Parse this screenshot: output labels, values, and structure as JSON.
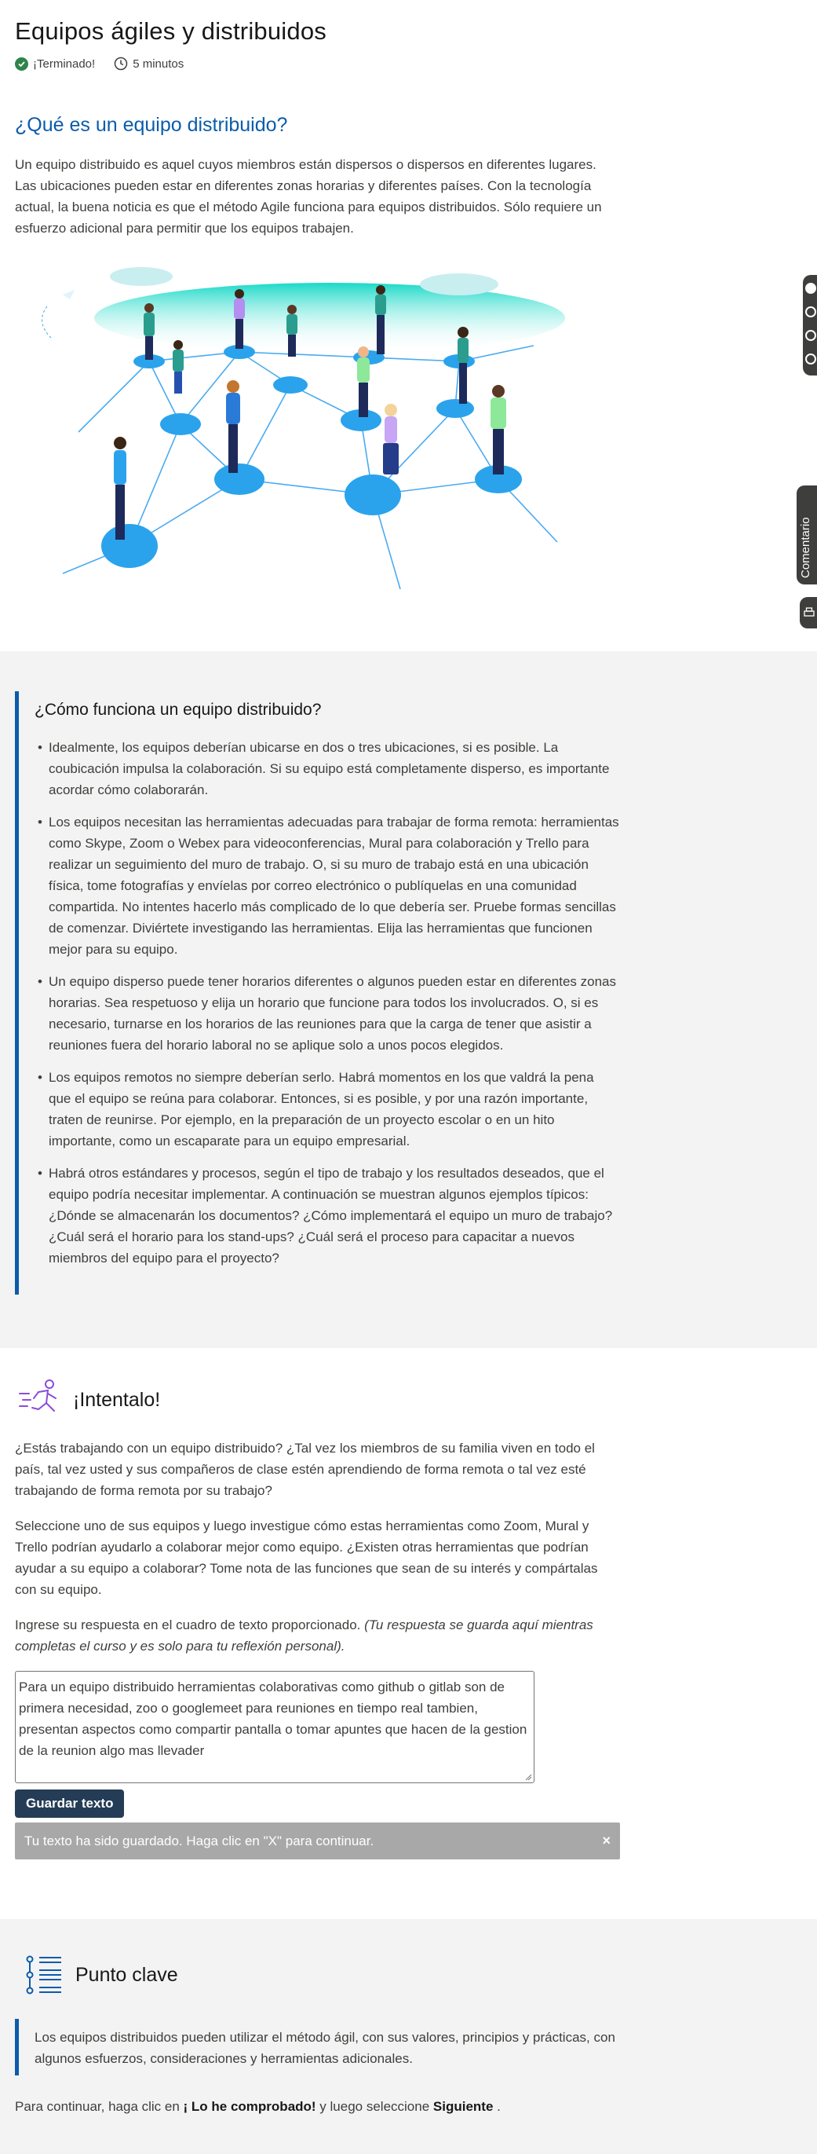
{
  "header": {
    "title": "Equipos ágiles y distribuidos",
    "status": "¡Terminado!",
    "duration": "5 minutos"
  },
  "intro": {
    "heading": "¿Qué es un equipo distribuido?",
    "paragraph": "Un equipo distribuido es aquel cuyos miembros están dispersos o dispersos en diferentes lugares. Las ubicaciones pueden estar en diferentes zonas horarias y diferentes países. Con la tecnología actual, la buena noticia es que el método Agile funciona para equipos distribuidos. Sólo requiere un esfuerzo adicional para permitir que los equipos trabajen."
  },
  "side_tabs": {
    "comment_label": "Comentario"
  },
  "how": {
    "heading": "¿Cómo funciona un equipo distribuido?",
    "bullets": [
      "Idealmente, los equipos deberían ubicarse en dos o tres ubicaciones, si es posible. La coubicación impulsa la colaboración. Si su equipo está completamente disperso, es importante acordar cómo colaborarán.",
      "Los equipos necesitan las herramientas adecuadas para trabajar de forma remota: herramientas como Skype, Zoom o Webex para videoconferencias, Mural para colaboración y Trello para realizar un seguimiento del muro de trabajo. O, si su muro de trabajo está en una ubicación física, tome fotografías y envíelas por correo electrónico o publíquelas en una comunidad compartida. No intentes hacerlo más complicado de lo que debería ser. Pruebe formas sencillas de comenzar. Diviértete investigando las herramientas. Elija las herramientas que funcionen mejor para su equipo.",
      "Un equipo disperso puede tener horarios diferentes o algunos pueden estar en diferentes zonas horarias. Sea respetuoso y elija un horario que funcione para todos los involucrados. O, si es necesario, turnarse en los horarios de las reuniones para que la carga de tener que asistir a reuniones fuera del horario laboral no se aplique solo a unos pocos elegidos.",
      "Los equipos remotos no siempre deberían serlo. Habrá momentos en los que valdrá la pena que el equipo se reúna para colaborar. Entonces, si es posible, y por una razón importante, traten de reunirse. Por ejemplo, en la preparación de un proyecto escolar o en un hito importante, como un escaparate para un equipo empresarial.",
      "Habrá otros estándares y procesos, según el tipo de trabajo y los resultados deseados, que el equipo podría necesitar implementar. A continuación se muestran algunos ejemplos típicos: ¿Dónde se almacenarán los documentos? ¿Cómo implementará el equipo un muro de trabajo? ¿Cuál será el horario para los stand-ups? ¿Cuál será el proceso para capacitar a nuevos miembros del equipo para el proyecto?"
    ]
  },
  "try_it": {
    "heading": "¡Intentalo!",
    "p1": "¿Estás trabajando con un equipo distribuido? ¿Tal vez los miembros de su familia viven en todo el país, tal vez usted y sus compañeros de clase estén aprendiendo de forma remota o tal vez esté trabajando de forma remota por su trabajo?",
    "p2": "Seleccione uno de sus equipos y luego investigue cómo estas herramientas como Zoom, Mural y Trello podrían ayudarlo a colaborar mejor como equipo. ¿Existen otras herramientas que podrían ayudar a su equipo a colaborar? Tome nota de las funciones que sean de su interés y compártalas con su equipo.",
    "p3_plain": "Ingrese su respuesta en el cuadro de texto proporcionado. ",
    "p3_italic": "(Tu respuesta se guarda aquí mientras completas el curso y es solo para tu reflexión personal).",
    "answer_value": "Para un equipo distribuido herramientas colaborativas como github o gitlab son de primera necesidad, zoo o googlemeet para reuniones en tiempo real tambien, presentan aspectos como compartir pantalla o tomar apuntes que hacen de la gestion de la reunion algo mas llevader",
    "save_label": "Guardar texto",
    "toast_text": "Tu texto ha sido guardado. Haga clic en \"X\" para continuar.",
    "toast_close": "×"
  },
  "key_point": {
    "heading": "Punto clave",
    "text": "Los equipos distribuidos pueden utilizar el método ágil, con sus valores, principios y prácticas, con algunos esfuerzos, consideraciones y herramientas adicionales."
  },
  "footer": {
    "prefix": "Para continuar, haga clic en ",
    "action1": "¡ Lo he comprobado!",
    "middle": " y luego seleccione ",
    "action2": " Siguiente",
    "suffix": " ."
  },
  "colors": {
    "accent_blue": "#0b5cab",
    "success_green": "#2e844a",
    "button_navy": "#243c56",
    "section_gray": "#f3f3f3",
    "toast_gray": "#a8a8a8"
  }
}
